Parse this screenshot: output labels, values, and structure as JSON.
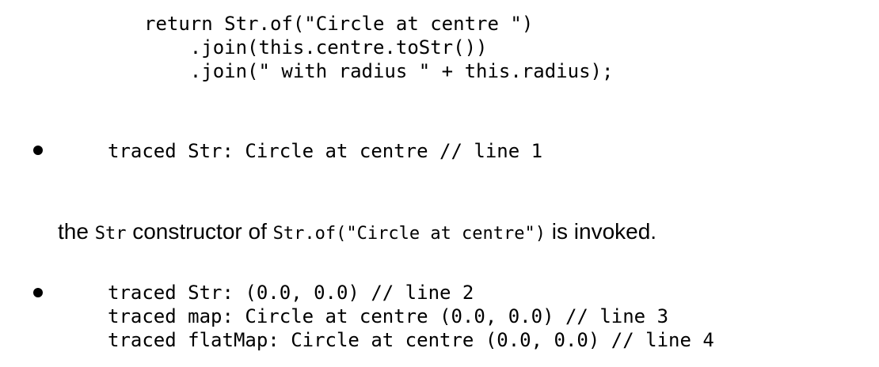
{
  "code_block": {
    "lines": [
      "return Str.of(\"Circle at centre \")",
      "    .join(this.centre.toStr())",
      "    .join(\" with radius \" + this.radius);"
    ]
  },
  "bullet_1": {
    "lines": [
      "traced Str: Circle at centre // line 1"
    ]
  },
  "paragraph": {
    "text_1": "the ",
    "code_1": "Str",
    "text_2": " constructor of ",
    "code_2": "Str.of(\"Circle at centre\")",
    "text_3": " is invoked."
  },
  "bullet_2": {
    "lines": [
      "traced Str: (0.0, 0.0) // line 2",
      "traced map: Circle at centre (0.0, 0.0) // line 3",
      "traced flatMap: Circle at centre (0.0, 0.0) // line 4"
    ]
  }
}
